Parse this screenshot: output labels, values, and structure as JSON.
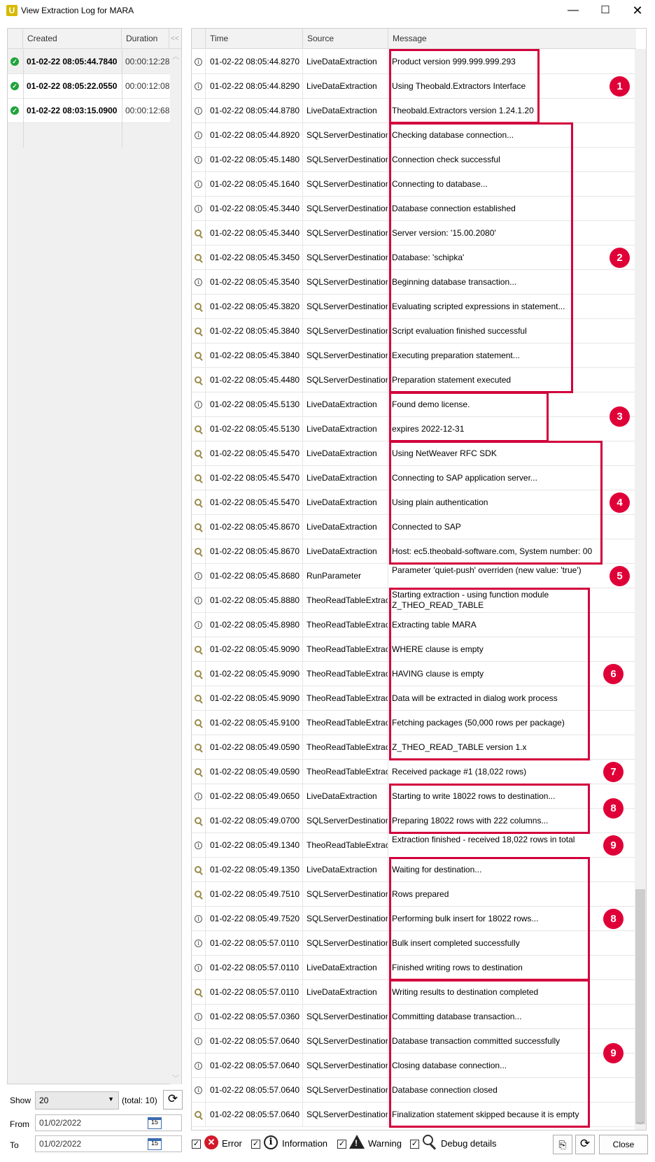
{
  "window": {
    "title": "View Extraction Log for MARA",
    "app_icon_letter": "U",
    "minimize": "—",
    "maximize": "☐",
    "close": "✕"
  },
  "runs": {
    "headers": {
      "created": "Created",
      "duration": "Duration",
      "collapse": "<<"
    },
    "items": [
      {
        "created": "01-02-22 08:05:44.7840",
        "duration": "00:00:12:28",
        "status": "success"
      },
      {
        "created": "01-02-22 08:05:22.0550",
        "duration": "00:00:12:08",
        "status": "success"
      },
      {
        "created": "01-02-22 08:03:15.0900",
        "duration": "00:00:12:68",
        "status": "success"
      }
    ]
  },
  "controls": {
    "show_label": "Show",
    "show_value": "20",
    "total": "(total: 10)",
    "from_label": "From",
    "from_value": "01/02/2022",
    "to_label": "To",
    "to_value": "01/02/2022",
    "calendar_day": "15"
  },
  "log": {
    "headers": {
      "time": "Time",
      "source": "Source",
      "message": "Message"
    },
    "rows": [
      {
        "type": "info",
        "time": "01-02-22 08:05:44.8270",
        "source": "LiveDataExtraction",
        "message": "Product version 999.999.999.293"
      },
      {
        "type": "info",
        "time": "01-02-22 08:05:44.8290",
        "source": "LiveDataExtraction",
        "message": "Using Theobald.Extractors Interface"
      },
      {
        "type": "info",
        "time": "01-02-22 08:05:44.8780",
        "source": "LiveDataExtraction",
        "message": "Theobald.Extractors version 1.24.1.20"
      },
      {
        "type": "info",
        "time": "01-02-22 08:05:44.8920",
        "source": "SQLServerDestination",
        "message": "Checking database connection..."
      },
      {
        "type": "info",
        "time": "01-02-22 08:05:45.1480",
        "source": "SQLServerDestination",
        "message": "Connection check successful"
      },
      {
        "type": "info",
        "time": "01-02-22 08:05:45.1640",
        "source": "SQLServerDestination",
        "message": "Connecting to database..."
      },
      {
        "type": "info",
        "time": "01-02-22 08:05:45.3440",
        "source": "SQLServerDestination",
        "message": "Database connection established"
      },
      {
        "type": "debug",
        "time": "01-02-22 08:05:45.3440",
        "source": "SQLServerDestination",
        "message": "Server version: '15.00.2080'"
      },
      {
        "type": "debug",
        "time": "01-02-22 08:05:45.3450",
        "source": "SQLServerDestination",
        "message": "Database: 'schipka'"
      },
      {
        "type": "info",
        "time": "01-02-22 08:05:45.3540",
        "source": "SQLServerDestination",
        "message": "Beginning database transaction..."
      },
      {
        "type": "debug",
        "time": "01-02-22 08:05:45.3820",
        "source": "SQLServerDestination",
        "message": "Evaluating scripted expressions in statement..."
      },
      {
        "type": "debug",
        "time": "01-02-22 08:05:45.3840",
        "source": "SQLServerDestination",
        "message": "Script evaluation finished successful"
      },
      {
        "type": "debug",
        "time": "01-02-22 08:05:45.3840",
        "source": "SQLServerDestination",
        "message": "Executing preparation statement..."
      },
      {
        "type": "debug",
        "time": "01-02-22 08:05:45.4480",
        "source": "SQLServerDestination",
        "message": "Preparation statement executed"
      },
      {
        "type": "info",
        "time": "01-02-22 08:05:45.5130",
        "source": "LiveDataExtraction",
        "message": "Found demo license."
      },
      {
        "type": "debug",
        "time": "01-02-22 08:05:45.5130",
        "source": "LiveDataExtraction",
        "message": "expires 2022-12-31"
      },
      {
        "type": "debug",
        "time": "01-02-22 08:05:45.5470",
        "source": "LiveDataExtraction",
        "message": "Using NetWeaver RFC SDK"
      },
      {
        "type": "debug",
        "time": "01-02-22 08:05:45.5470",
        "source": "LiveDataExtraction",
        "message": "Connecting to SAP application server..."
      },
      {
        "type": "debug",
        "time": "01-02-22 08:05:45.5470",
        "source": "LiveDataExtraction",
        "message": "Using plain authentication"
      },
      {
        "type": "debug",
        "time": "01-02-22 08:05:45.8670",
        "source": "LiveDataExtraction",
        "message": "Connected to SAP"
      },
      {
        "type": "debug",
        "time": "01-02-22 08:05:45.8670",
        "source": "LiveDataExtraction",
        "message": "Host: ec5.theobald-software.com, System number: 00"
      },
      {
        "type": "info",
        "time": "01-02-22 08:05:45.8680",
        "source": "RunParameter",
        "message": "Parameter 'quiet-push' overriden (new value: 'true')"
      },
      {
        "type": "info",
        "time": "01-02-22 08:05:45.8880",
        "source": "TheoReadTableExtract",
        "message": "Starting extraction - using function module Z_THEO_READ_TABLE"
      },
      {
        "type": "info",
        "time": "01-02-22 08:05:45.8980",
        "source": "TheoReadTableExtract",
        "message": "Extracting table MARA"
      },
      {
        "type": "debug",
        "time": "01-02-22 08:05:45.9090",
        "source": "TheoReadTableExtract",
        "message": "WHERE clause is empty"
      },
      {
        "type": "debug",
        "time": "01-02-22 08:05:45.9090",
        "source": "TheoReadTableExtract",
        "message": "HAVING clause is empty"
      },
      {
        "type": "debug",
        "time": "01-02-22 08:05:45.9090",
        "source": "TheoReadTableExtract",
        "message": "Data will be extracted in dialog work process"
      },
      {
        "type": "debug",
        "time": "01-02-22 08:05:45.9100",
        "source": "TheoReadTableExtract",
        "message": "Fetching packages (50,000 rows per package)"
      },
      {
        "type": "debug",
        "time": "01-02-22 08:05:49.0590",
        "source": "TheoReadTableExtract",
        "message": "Z_THEO_READ_TABLE version 1.x"
      },
      {
        "type": "debug",
        "time": "01-02-22 08:05:49.0590",
        "source": "TheoReadTableExtract",
        "message": "Received package #1 (18,022 rows)"
      },
      {
        "type": "info",
        "time": "01-02-22 08:05:49.0650",
        "source": "LiveDataExtraction",
        "message": "Starting to write 18022 rows to destination..."
      },
      {
        "type": "debug",
        "time": "01-02-22 08:05:49.0700",
        "source": "SQLServerDestination",
        "message": "Preparing 18022 rows with 222 columns..."
      },
      {
        "type": "info",
        "time": "01-02-22 08:05:49.1340",
        "source": "TheoReadTableExtract",
        "message": "Extraction finished - received 18,022 rows in total"
      },
      {
        "type": "debug",
        "time": "01-02-22 08:05:49.1350",
        "source": "LiveDataExtraction",
        "message": "Waiting for destination..."
      },
      {
        "type": "debug",
        "time": "01-02-22 08:05:49.7510",
        "source": "SQLServerDestination",
        "message": "Rows prepared"
      },
      {
        "type": "info",
        "time": "01-02-22 08:05:49.7520",
        "source": "SQLServerDestination",
        "message": "Performing bulk insert for 18022 rows..."
      },
      {
        "type": "info",
        "time": "01-02-22 08:05:57.0110",
        "source": "SQLServerDestination",
        "message": "Bulk insert completed successfully"
      },
      {
        "type": "info",
        "time": "01-02-22 08:05:57.0110",
        "source": "LiveDataExtraction",
        "message": "Finished writing rows to destination"
      },
      {
        "type": "debug",
        "time": "01-02-22 08:05:57.0110",
        "source": "LiveDataExtraction",
        "message": "Writing results to destination completed"
      },
      {
        "type": "info",
        "time": "01-02-22 08:05:57.0360",
        "source": "SQLServerDestination",
        "message": "Committing database transaction..."
      },
      {
        "type": "info",
        "time": "01-02-22 08:05:57.0640",
        "source": "SQLServerDestination",
        "message": "Database transaction committed successfully"
      },
      {
        "type": "info",
        "time": "01-02-22 08:05:57.0640",
        "source": "SQLServerDestination",
        "message": "Closing database connection..."
      },
      {
        "type": "info",
        "time": "01-02-22 08:05:57.0640",
        "source": "SQLServerDestination",
        "message": "Database connection closed"
      },
      {
        "type": "debug",
        "time": "01-02-22 08:05:57.0640",
        "source": "SQLServerDestination",
        "message": "Finalization statement skipped because it is empty"
      }
    ]
  },
  "annotations": [
    {
      "number": "1"
    },
    {
      "number": "2"
    },
    {
      "number": "3"
    },
    {
      "number": "4"
    },
    {
      "number": "5"
    },
    {
      "number": "6"
    },
    {
      "number": "7"
    },
    {
      "number": "8"
    },
    {
      "number": "9"
    },
    {
      "number": "8"
    },
    {
      "number": "9"
    }
  ],
  "filters": {
    "error": {
      "label": "Error",
      "checked": true
    },
    "information": {
      "label": "Information",
      "checked": true
    },
    "warning": {
      "label": "Warning",
      "checked": true
    },
    "debug": {
      "label": "Debug details",
      "checked": true
    }
  },
  "buttons": {
    "close": "Close"
  },
  "colors": {
    "highlight": "#d2003c",
    "badge": "#e00038",
    "success": "#1fa33a",
    "error": "#d11a2a"
  }
}
